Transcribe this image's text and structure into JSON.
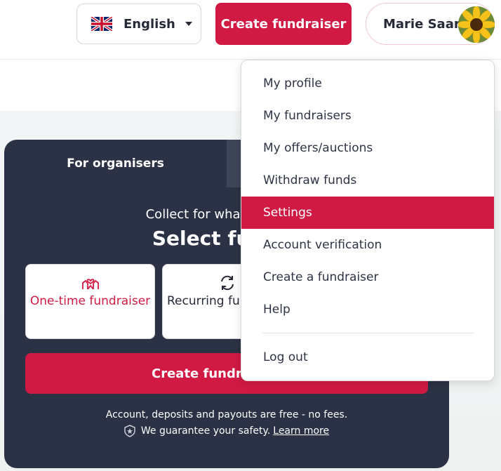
{
  "header": {
    "language_label": "English",
    "create_label": "Create fundraiser",
    "user_name": "Marie Saar",
    "flag_icon": "uk-flag-icon",
    "avatar_icon": "sunflower-avatar"
  },
  "card": {
    "tab_label": "For organisers",
    "subtitle": "Collect for what you want",
    "title": "Select fundra",
    "options": [
      {
        "label": "One-time fundraiser",
        "icon": "hands-heart-icon"
      },
      {
        "label": "Recurring fun",
        "icon": "refresh-icon"
      }
    ],
    "create_label": "Create fundraiser - →",
    "fees_text": "Account, deposits and payouts are free - no fees.",
    "safety_text": "We guarantee your safety.",
    "learn_more": "Learn more"
  },
  "menu": {
    "items": [
      {
        "label": "My profile"
      },
      {
        "label": "My fundraisers"
      },
      {
        "label": "My offers/auctions"
      },
      {
        "label": "Withdraw funds"
      },
      {
        "label": "Settings"
      },
      {
        "label": "Account verification"
      },
      {
        "label": "Create a fundraiser"
      },
      {
        "label": "Help"
      }
    ],
    "logout": "Log out",
    "active_index": 4
  },
  "colors": {
    "accent": "#d11a43",
    "card_bg": "#2b3245",
    "text_dark": "#262a36"
  }
}
